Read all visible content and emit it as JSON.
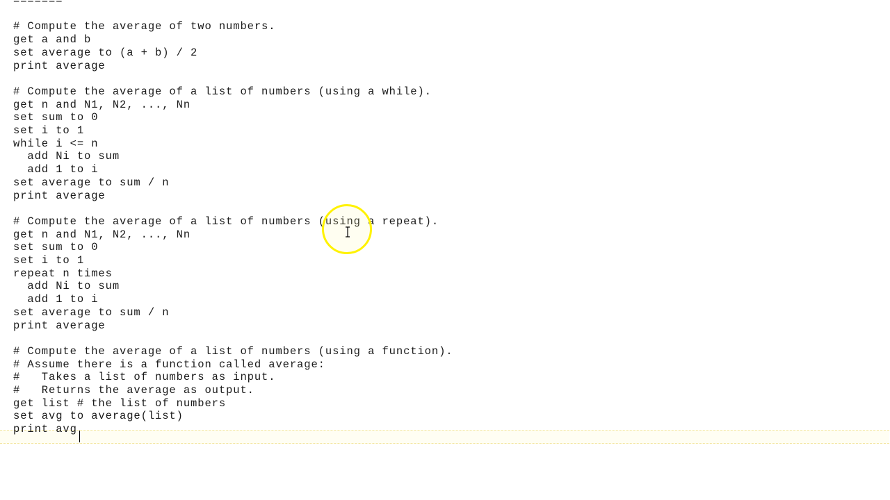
{
  "editor": {
    "lines": [
      "=======",
      "",
      "# Compute the average of two numbers.",
      "get a and b",
      "set average to (a + b) / 2",
      "print average",
      "",
      "# Compute the average of a list of numbers (using a while).",
      "get n and N1, N2, ..., Nn",
      "set sum to 0",
      "set i to 1",
      "while i <= n",
      "  add Ni to sum",
      "  add 1 to i",
      "set average to sum / n",
      "print average",
      "",
      "# Compute the average of a list of numbers (using a repeat).",
      "get n and N1, N2, ..., Nn",
      "set sum to 0",
      "set i to 1",
      "repeat n times",
      "  add Ni to sum",
      "  add 1 to i",
      "set average to sum / n",
      "print average",
      "",
      "# Compute the average of a list of numbers (using a function).",
      "# Assume there is a function called average:",
      "#   Takes a list of numbers as input.",
      "#   Returns the average as output.",
      "get list # the list of numbers",
      "set avg to average(list)",
      "print avg"
    ]
  }
}
